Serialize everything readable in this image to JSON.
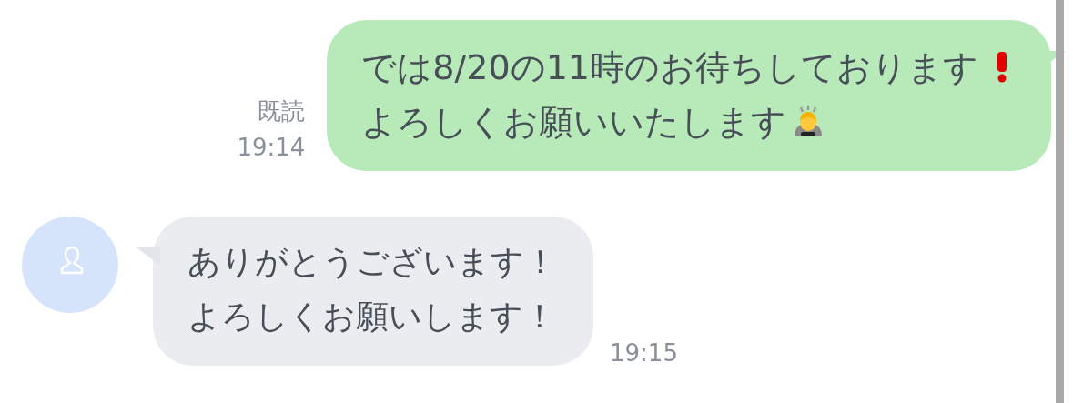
{
  "messages": [
    {
      "kind": "outgoing",
      "read_label": "既読",
      "time": "19:14",
      "lines": [
        {
          "text": "では8/20の11時のお待ちしております",
          "kind": "exclamation"
        },
        {
          "text": "よろしくお願いいたします",
          "kind": "bowing"
        }
      ]
    },
    {
      "kind": "incoming",
      "time": "19:15",
      "lines": [
        {
          "text": "ありがとうございます！"
        },
        {
          "text": "よろしくお願いします！"
        }
      ]
    }
  ]
}
